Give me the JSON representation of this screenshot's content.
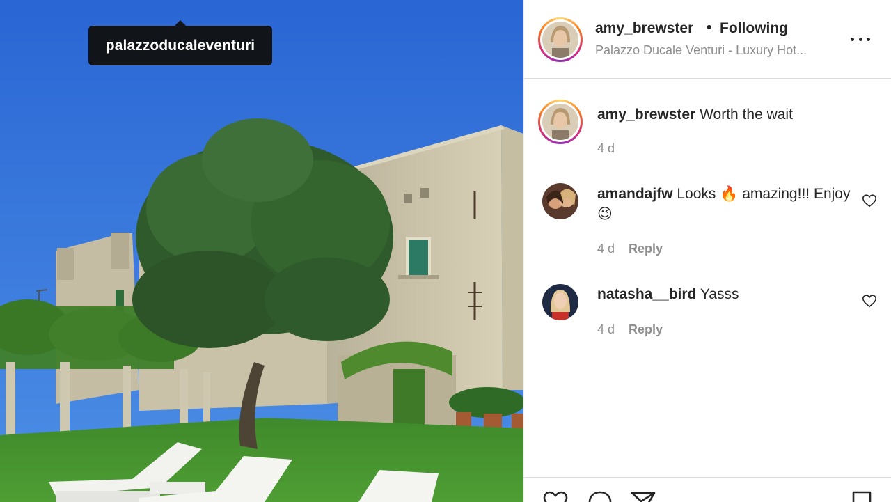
{
  "photo": {
    "tag_label": "palazzoducaleventuri"
  },
  "header": {
    "username": "amy_brewster",
    "separator": "•",
    "follow_status": "Following",
    "location": "Palazzo Ducale Venturi - Luxury Hot..."
  },
  "comments": [
    {
      "username": "amy_brewster",
      "text": "Worth the wait",
      "time": "4 d",
      "reply_label": "",
      "is_caption": true
    },
    {
      "username": "amandajfw",
      "text": "Looks 🔥 amazing!!! Enjoy 😉",
      "time": "4 d",
      "reply_label": "Reply"
    },
    {
      "username": "natasha__bird",
      "text": "Yasss",
      "time": "4 d",
      "reply_label": "Reply"
    }
  ],
  "icons": {
    "more": "more-options-icon",
    "like_comment": "heart-outline-icon",
    "actions": [
      "heart-icon",
      "comment-icon",
      "share-icon",
      "bookmark-icon"
    ]
  },
  "colors": {
    "sky": "#2f6fd6",
    "grass": "#3f8f2e",
    "text_primary": "#262626",
    "text_secondary": "#8e8e8e"
  }
}
